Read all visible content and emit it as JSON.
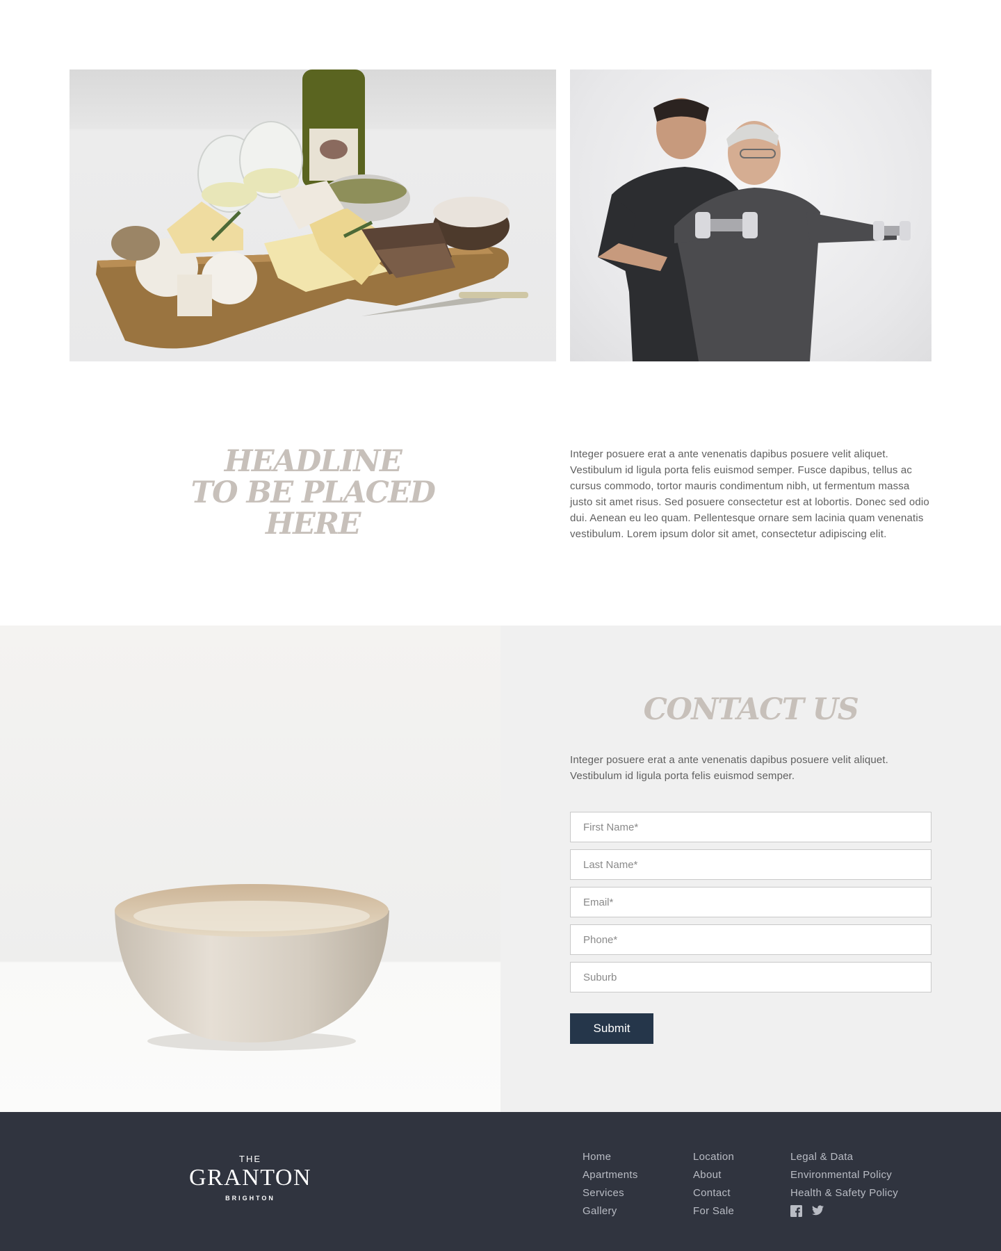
{
  "gallery": {
    "images": [
      {
        "alt": "Cheese board with white wine",
        "icon": "cheese-board-photo"
      },
      {
        "alt": "Personal trainer assisting senior man with dumbbells",
        "icon": "fitness-training-photo"
      }
    ]
  },
  "feature": {
    "headline_lines": [
      "HEADLINE",
      "TO BE PLACED",
      "HERE"
    ],
    "body": "Integer posuere erat a ante venenatis dapibus posuere velit aliquet. Vestibulum id ligula porta felis euismod semper. Fusce dapibus, tellus ac cursus commodo, tortor mauris condimentum nibh, ut fermentum massa justo sit amet risus. Sed posuere consectetur est at lobortis. Donec sed odio dui. Aenean eu leo quam. Pellentesque ornare sem lacinia quam venenatis vestibulum. Lorem ipsum dolor sit amet, consectetur adipiscing elit."
  },
  "contact": {
    "title": "CONTACT US",
    "text": "Integer posuere erat a ante venenatis dapibus posuere velit aliquet. Vestibulum id ligula porta felis euismod semper.",
    "fields": {
      "first_name": {
        "placeholder": "First Name*",
        "value": ""
      },
      "last_name": {
        "placeholder": "Last Name*",
        "value": ""
      },
      "email": {
        "placeholder": "Email*",
        "value": ""
      },
      "phone": {
        "placeholder": "Phone*",
        "value": ""
      },
      "suburb": {
        "placeholder": "Suburb",
        "value": ""
      }
    },
    "submit_label": "Submit"
  },
  "footer": {
    "logo": {
      "the": "THE",
      "name": "GRANTON",
      "location": "BRIGHTON"
    },
    "col1": [
      "Home",
      "Apartments",
      "Services",
      "Gallery"
    ],
    "col2": [
      "Location",
      "About",
      "Contact",
      "For Sale"
    ],
    "col3": [
      "Legal & Data",
      "Environmental Policy",
      "Health & Safety Policy"
    ],
    "socials": [
      "facebook-icon",
      "twitter-icon"
    ]
  },
  "colors": {
    "accent_heading": "#c7c0ba",
    "button": "#25364a",
    "footer_bg": "#30343f",
    "footer_link": "#b9bcc4"
  }
}
